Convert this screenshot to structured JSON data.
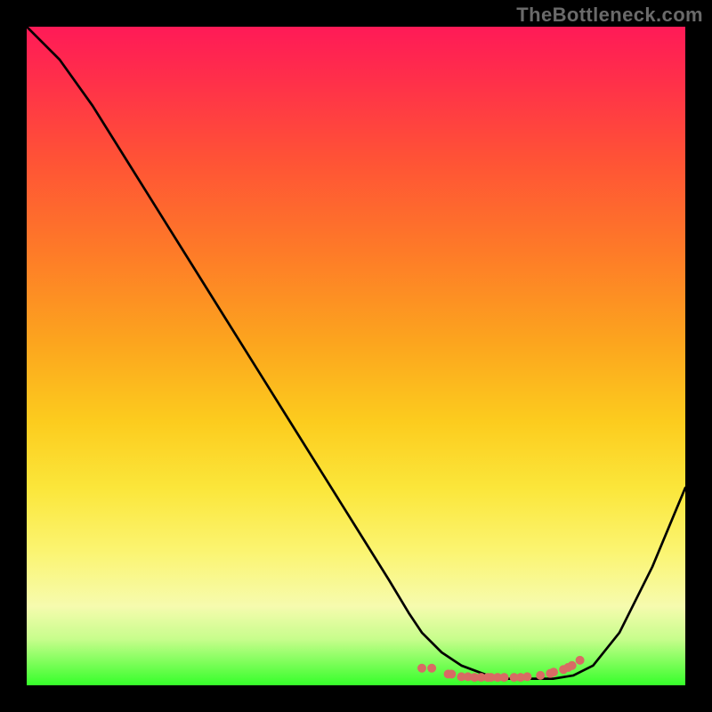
{
  "watermark": "TheBottleneck.com",
  "chart_data": {
    "type": "line",
    "title": "",
    "xlabel": "",
    "ylabel": "",
    "xlim": [
      0,
      100
    ],
    "ylim": [
      0,
      100
    ],
    "series": [
      {
        "name": "bottleneck-curve",
        "x": [
          0,
          5,
          10,
          15,
          20,
          25,
          30,
          35,
          40,
          45,
          50,
          55,
          58,
          60,
          63,
          66,
          70,
          73,
          76,
          80,
          83,
          86,
          90,
          95,
          100
        ],
        "y": [
          100,
          95,
          88,
          80,
          72,
          64,
          56,
          48,
          40,
          32,
          24,
          16,
          11,
          8,
          5,
          3,
          1.5,
          1,
          1,
          1,
          1.5,
          3,
          8,
          18,
          30
        ]
      }
    ],
    "markers": {
      "name": "flat-valley-dots",
      "color": "#d86b64",
      "x": [
        60,
        61.5,
        64,
        64.5,
        66,
        67,
        68,
        69,
        70,
        70.5,
        71.5,
        72.5,
        74,
        75,
        76,
        78,
        79.5,
        80,
        81.5,
        82.2,
        82.8,
        84
      ],
      "y": [
        2.6,
        2.6,
        1.7,
        1.7,
        1.3,
        1.3,
        1.2,
        1.2,
        1.2,
        1.2,
        1.2,
        1.2,
        1.2,
        1.2,
        1.3,
        1.5,
        1.8,
        2.0,
        2.4,
        2.7,
        3.0,
        3.8
      ]
    },
    "gradient_stops": [
      {
        "pos": 0.0,
        "color": "#ff1a57"
      },
      {
        "pos": 0.08,
        "color": "#ff2f4a"
      },
      {
        "pos": 0.2,
        "color": "#ff5236"
      },
      {
        "pos": 0.34,
        "color": "#fe7a28"
      },
      {
        "pos": 0.48,
        "color": "#fca51e"
      },
      {
        "pos": 0.6,
        "color": "#fccc1e"
      },
      {
        "pos": 0.7,
        "color": "#fbe63a"
      },
      {
        "pos": 0.8,
        "color": "#fbf573"
      },
      {
        "pos": 0.88,
        "color": "#f6fbae"
      },
      {
        "pos": 0.93,
        "color": "#c7fd8c"
      },
      {
        "pos": 1.0,
        "color": "#36ff2a"
      }
    ]
  }
}
